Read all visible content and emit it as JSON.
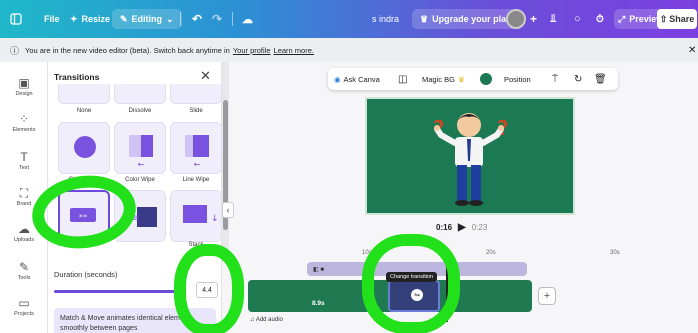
{
  "topbar": {
    "file": "File",
    "resize": "Resize",
    "editing": "Editing",
    "user": "s indra",
    "upgrade": "Upgrade your plan",
    "preview": "Preview",
    "share": "Share"
  },
  "infobar": {
    "message": "You are in the new video editor (beta). Switch back anytime in",
    "profile_link": "Your profile",
    "learn_more": "Learn more."
  },
  "rail": {
    "items": [
      "Design",
      "Elements",
      "Text",
      "Brand",
      "Uploads",
      "Tools",
      "Projects"
    ]
  },
  "panel": {
    "title": "Transitions",
    "transitions": [
      "None",
      "Dissolve",
      "Slide",
      "Circle Wipe",
      "Color Wipe",
      "Line Wipe",
      "Match & Move",
      "",
      "Stack"
    ],
    "duration_label": "Duration (seconds)",
    "duration_value": "4.4",
    "description": "Match & Move animates identical elements smoothly between pages"
  },
  "context_toolbar": {
    "ask_canva": "Ask Canva",
    "magic_bg": "Magic BG",
    "position": "Position"
  },
  "playback": {
    "current": "0:16",
    "total": "0:23"
  },
  "timeline": {
    "ruler": [
      "10s",
      "20s",
      "30s"
    ],
    "clip_duration": "8.9s",
    "tooltip": "Change transition",
    "add_audio": "Add audio"
  },
  "colors": {
    "stage_bg": "#1b7a53",
    "accent": "#6c4bd8",
    "annotation": "#22e01a"
  }
}
